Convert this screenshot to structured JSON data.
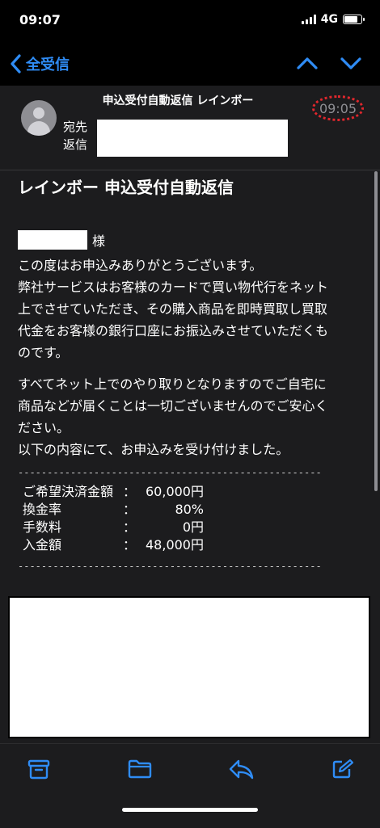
{
  "status": {
    "time": "09:07",
    "network": "4G"
  },
  "nav": {
    "back_label": "全受信"
  },
  "header": {
    "subject": "申込受付自動返信 レインボー",
    "to_label": "宛先",
    "reply_label": "返信",
    "time": "09:05"
  },
  "body": {
    "title": "レインボー 申込受付自動返信",
    "honorific": "様",
    "para1": [
      "この度はお申込みありがとうございます。",
      "弊社サービスはお客様のカードで買い物代行をネット",
      "上でさせていただき、その購入商品を即時買取し買取",
      "代金をお客様の銀行口座にお振込みさせていただくも",
      "のです。"
    ],
    "para2": [
      "すべてネット上でのやり取りとなりますのでご自宅に",
      "商品などが届くことは一切ございませんのでご安心く",
      "ださい。",
      "以下の内容にて、お申込みを受け付けました。"
    ],
    "divider": "----------------------------------------------------",
    "table": [
      {
        "key": "ご希望決済金額",
        "colon": "：",
        "value": "60,000円"
      },
      {
        "key": "換金率",
        "colon": "：",
        "value": "80%"
      },
      {
        "key": "手数料",
        "colon": "：",
        "value": "0円"
      },
      {
        "key": "入金額",
        "colon": "：",
        "value": "48,000円"
      }
    ]
  },
  "toolbar": {
    "icons": [
      "archive-icon",
      "folder-icon",
      "reply-icon",
      "compose-icon"
    ]
  },
  "colors": {
    "accent": "#2f8cf5",
    "background": "#1c1c1e",
    "annotation": "#e0272d"
  }
}
